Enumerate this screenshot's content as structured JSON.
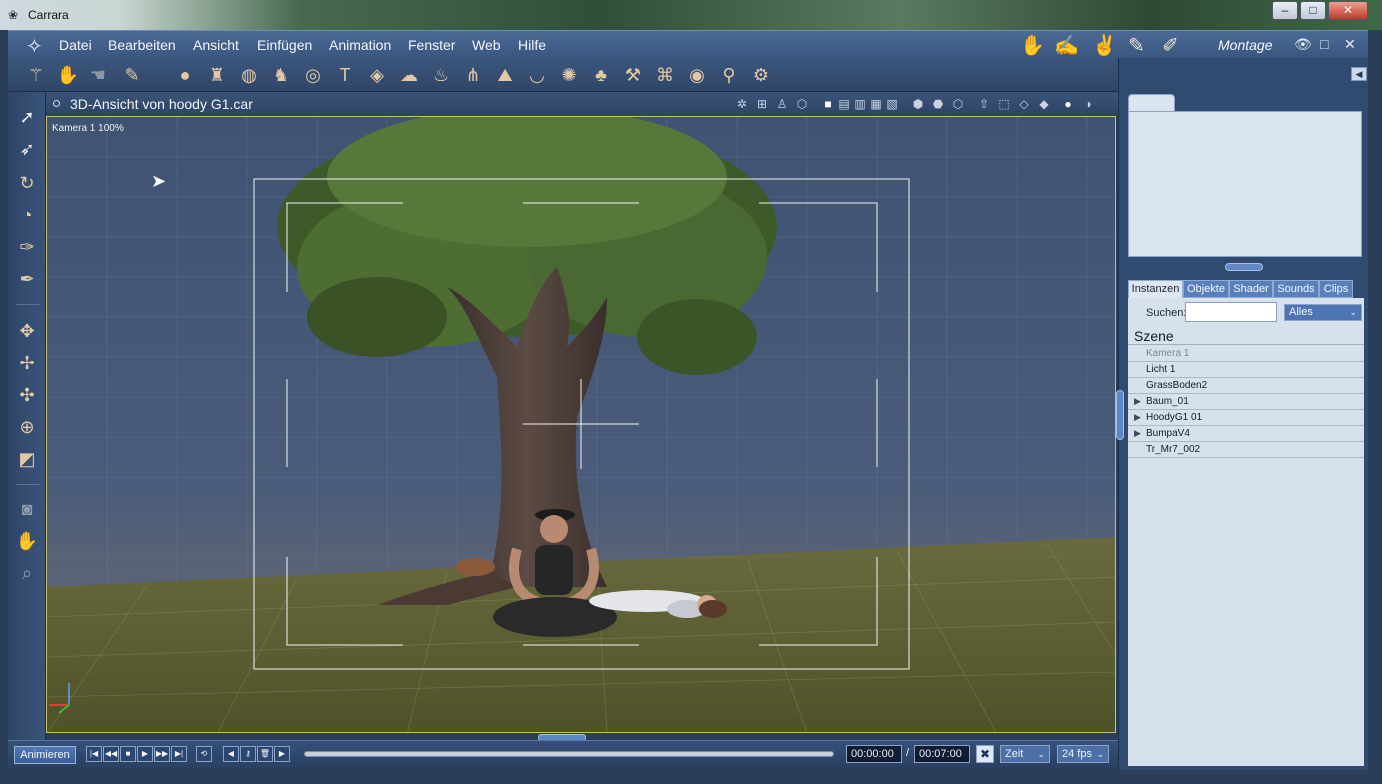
{
  "window": {
    "title": "Carrara",
    "controls": {
      "minimize": "–",
      "maximize": "□",
      "close": "✕"
    }
  },
  "menubar": {
    "items": [
      "Datei",
      "Bearbeiten",
      "Ansicht",
      "Einfügen",
      "Animation",
      "Fenster",
      "Web",
      "Hilfe"
    ],
    "room_label": "Montage",
    "room_icons": [
      "hand-assemble-icon",
      "hand-model-icon",
      "hand-storyboard-icon",
      "hand-texture-icon",
      "hand-render-icon"
    ],
    "right_controls": {
      "eye": "👁",
      "square": "□",
      "close": "✕"
    }
  },
  "toolbar": {
    "icons": [
      "wand-icon",
      "hand-icon",
      "hand-gray-icon",
      "pen-book-icon",
      "sphere-icon",
      "vase-icon",
      "globe-icon",
      "figure-icon",
      "torus-icon",
      "text-icon",
      "plane-icon",
      "cloud-icon",
      "fire-icon",
      "grass-icon",
      "terrain-icon",
      "bowl-icon",
      "cluster-icon",
      "tree-icon",
      "hammer-icon",
      "camera-icon",
      "ring-icon",
      "bone-icon",
      "gear-icon"
    ]
  },
  "leftbar": {
    "icons": [
      "select-arrow-icon",
      "direct-select-icon",
      "rotate-icon",
      "roll-icon",
      "eyedropper-icon",
      "paint-icon",
      "move-icon",
      "move-plane-icon",
      "scale-icon",
      "bone-move-icon",
      "box-icon",
      "camera-icon",
      "pan-hand-icon",
      "zoom-icon"
    ]
  },
  "view": {
    "title": "3D-Ansicht von hoody  G1.car",
    "camera_label": "Kamera 1 100%",
    "header_icons": [
      "scene-icon",
      "stack-icon",
      "figure-icon",
      "hexagon-icon",
      "single-view-icon",
      "two-view-icon",
      "three-view-icon",
      "four-view-icon",
      "custom-view-icon",
      "wireframe-box-icon",
      "shaded-box-icon",
      "outline-box-icon",
      "arrow-icon",
      "dashed-cube-icon",
      "cube-icon",
      "solid-cube-icon",
      "sphere-icon",
      "half-sphere-icon"
    ]
  },
  "timeline": {
    "animate_label": "Animieren",
    "transport": [
      "|◀",
      "◀◀",
      "■",
      "▶",
      "▶▶",
      "▶|"
    ],
    "loop_label": "⟲",
    "key_controls": [
      "◀",
      "⚷",
      "🗑",
      "▶"
    ],
    "current_time": "00:00:00",
    "separator": "/",
    "end_time": "00:07:00",
    "mode_select": "Zeit",
    "fps_select": "24 fps"
  },
  "rightpanel": {
    "collapse_label": "◀",
    "tabs": [
      "Instanzen",
      "Objekte",
      "Shader",
      "Sounds",
      "Clips"
    ],
    "active_tab": 0,
    "search_label": "Suchen:",
    "search_value": "",
    "filter_select": "Alles",
    "scene_title": "Szene",
    "scene_items": [
      {
        "name": "Kamera 1",
        "expandable": false,
        "dimmed": true
      },
      {
        "name": "Licht 1",
        "expandable": false,
        "dimmed": false
      },
      {
        "name": "GrassBoden2",
        "expandable": false,
        "dimmed": false
      },
      {
        "name": "Baum_01",
        "expandable": true,
        "dimmed": false
      },
      {
        "name": "HoodyG1 01",
        "expandable": true,
        "dimmed": false
      },
      {
        "name": "BumpaV4",
        "expandable": true,
        "dimmed": false
      },
      {
        "name": "Tr_Mr7_002",
        "expandable": false,
        "dimmed": false
      }
    ]
  }
}
